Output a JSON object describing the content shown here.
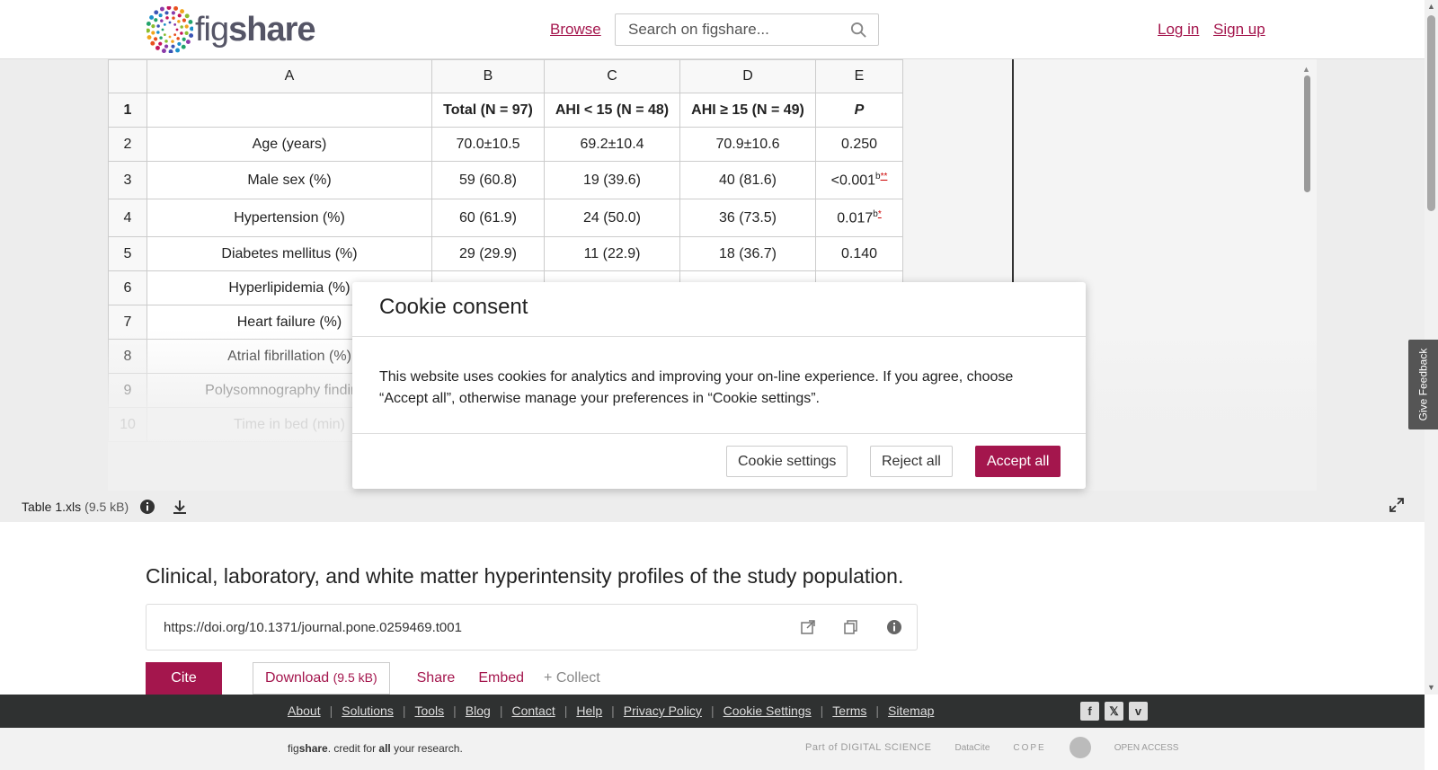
{
  "header": {
    "logo_fig": "fig",
    "logo_share": "share",
    "browse": "Browse",
    "search_placeholder": "Search on figshare...",
    "login": "Log in",
    "signup": "Sign up"
  },
  "sheet": {
    "columns": [
      "A",
      "B",
      "C",
      "D",
      "E"
    ],
    "rows": [
      {
        "n": "1",
        "a": "",
        "b": "Total (N = 97)",
        "c": "AHI < 15 (N = 48)",
        "d": "AHI ≥ 15 (N = 49)",
        "e": "P"
      },
      {
        "n": "2",
        "a": "Age (years)",
        "b": "70.0±10.5",
        "c": "69.2±10.4",
        "d": "70.9±10.6",
        "e": "0.250"
      },
      {
        "n": "3",
        "a": "Male sex (%)",
        "b": "59 (60.8)",
        "c": "19 (39.6)",
        "d": "40 (81.6)",
        "e": "<0.001",
        "e_sup": "b",
        "e_sup_red": "**"
      },
      {
        "n": "4",
        "a": "Hypertension (%)",
        "b": "60 (61.9)",
        "c": "24 (50.0)",
        "d": "36 (73.5)",
        "e": "0.017",
        "e_sup": "b",
        "e_sup_red": "*"
      },
      {
        "n": "5",
        "a": "Diabetes mellitus (%)",
        "b": "29 (29.9)",
        "c": "11 (22.9)",
        "d": "18 (36.7)",
        "e": "0.140"
      },
      {
        "n": "6",
        "a": "Hyperlipidemia (%)",
        "b": "",
        "c": "",
        "d": "",
        "e": ""
      },
      {
        "n": "7",
        "a": "Heart failure (%)",
        "b": "",
        "c": "",
        "d": "",
        "e": ""
      },
      {
        "n": "8",
        "a": "Atrial fibrillation (%)",
        "b": "",
        "c": "",
        "d": "",
        "e": ""
      },
      {
        "n": "9",
        "a": "Polysomnography findings",
        "b": "",
        "c": "",
        "d": "",
        "e": ""
      },
      {
        "n": "10",
        "a": "Time in bed (min)",
        "b": "",
        "c": "",
        "d": "",
        "e": ""
      }
    ]
  },
  "file": {
    "name": "Table 1.xls",
    "size": "(9.5 kB)"
  },
  "main": {
    "title": "Clinical, laboratory, and white matter hyperintensity profiles of the study population.",
    "doi": "https://doi.org/10.1371/journal.pone.0259469.t001",
    "cite": "Cite",
    "download": "Download",
    "download_size": "(9.5 kB)",
    "share": "Share",
    "embed": "Embed",
    "collect": "+ Collect"
  },
  "footer": {
    "links": [
      "About",
      "Solutions",
      "Tools",
      "Blog",
      "Contact",
      "Help",
      "Privacy Policy",
      "Cookie Settings",
      "Terms",
      "Sitemap"
    ],
    "tagline_fig": "fig",
    "tagline_share": "share",
    "tagline_rest1": ". credit for ",
    "tagline_all": "all",
    "tagline_rest2": " your research.",
    "partner_ds": "Part of DIGITAL SCIENCE",
    "partner_datacite": "DataCite",
    "partner_cope": "COPE",
    "partner_oa": "OPEN ACCESS"
  },
  "feedback": "Give Feedback",
  "modal": {
    "title": "Cookie consent",
    "body": "This website uses cookies for analytics and improving your on-line experience. If you agree, choose “Accept all”, otherwise manage your preferences in “Cookie settings”.",
    "settings": "Cookie settings",
    "reject": "Reject all",
    "accept": "Accept all"
  },
  "colors": {
    "brand": "#a4164d",
    "footer_dark": "#2f3131"
  }
}
